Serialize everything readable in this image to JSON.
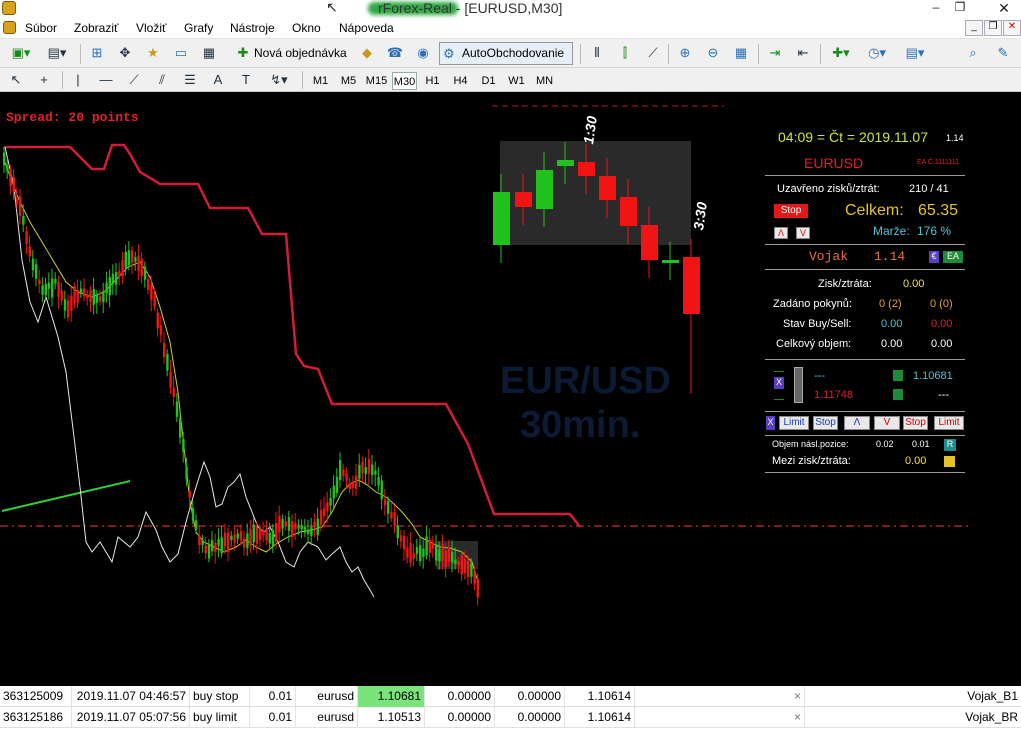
{
  "window": {
    "title": "rForex-Real - [EURUSD,M30]"
  },
  "menu": [
    "Súbor",
    "Zobraziť",
    "Vložiť",
    "Grafy",
    "Nástroje",
    "Okno",
    "Nápoveda"
  ],
  "toolbar": {
    "new_order_label": "Nová objednávka",
    "auto_trading_label": "AutoObchodovanie"
  },
  "timeframes": [
    "M1",
    "M5",
    "M15",
    "M30",
    "H1",
    "H4",
    "D1",
    "W1",
    "MN"
  ],
  "timeframe_active": "M30",
  "chart": {
    "symbol": "EURUSD",
    "timeframe": "M30",
    "spread_text": "Spread: 20 points",
    "watermark_line1": "EUR/USD",
    "watermark_line2": "30min.",
    "clock1": "1:30",
    "clock2": "3:30",
    "colors": {
      "bull": "#21c21e",
      "bear": "#f01414",
      "envelope": "#d31b3a",
      "hline": "#c8283a"
    }
  },
  "panel": {
    "time_line": "04:09 = Čt = 2019.11.07",
    "time_suffix": "1.14",
    "symbol": "EURUSD",
    "ea_tag": "EA Č.1111111",
    "closed_label": "Uzavřeno zisků/ztrát:",
    "closed_value": "210 / 41",
    "stop_button": "Stop",
    "total_label": "Celkem:",
    "total_value": "65.35",
    "margin_label": "Marže:",
    "margin_value": "176 %",
    "small_btn_up": "Λ",
    "small_btn_down": "V",
    "name": "Vojak",
    "version": "1.14",
    "euro_tag": "€",
    "ea_badge": "EA",
    "profit_label": "Zisk/ztráta:",
    "profit_value": "0.00",
    "orders_label": "Zadáno pokynů:",
    "orders_buy": "0 (2)",
    "orders_sell": "0 (0)",
    "state_label": "Stav Buy/Sell:",
    "state_buy": "0.00",
    "state_sell": "0.00",
    "volume_label": "Celkový objem:",
    "volume_buy": "0.00",
    "volume_sell": "0.00",
    "x_tag": "X",
    "dash_top": "---",
    "price_green": "1.10681",
    "price_red": "1.11748",
    "dash_bottom": "---",
    "btn_x": "X",
    "btn_limit1": "Limit",
    "btn_stop1": "Stop",
    "btn_up": "Λ",
    "btn_down": "V",
    "btn_stop2": "Stop",
    "btn_limit2": "Limit",
    "next_vol_label": "Objem násl.pozice:",
    "next_vol_a": "0.02",
    "next_vol_b": "0.01",
    "r_tag": "R",
    "between_label": "Mezi zisk/ztráta:",
    "between_value": "0.00"
  },
  "orders": [
    {
      "ticket": "363125009",
      "time": "2019.11.07 04:46:57",
      "type": "buy stop",
      "volume": "0.01",
      "symbol": "eurusd",
      "price": "1.10681",
      "sl": "0.00000",
      "tp": "0.00000",
      "current": "1.10614",
      "comment": "Vojak_B1"
    },
    {
      "ticket": "363125186",
      "time": "2019.11.07 05:07:56",
      "type": "buy limit",
      "volume": "0.01",
      "symbol": "eurusd",
      "price": "1.10513",
      "sl": "0.00000",
      "tp": "0.00000",
      "current": "1.10614",
      "comment": "Vojak_BR"
    }
  ],
  "close_icon": "×"
}
